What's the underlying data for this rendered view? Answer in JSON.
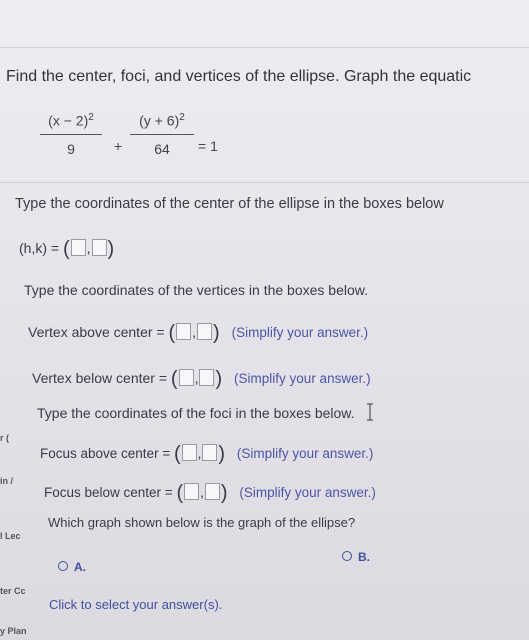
{
  "question": "Find the center, foci, and vertices of the ellipse. Graph the equatic",
  "equation": {
    "term1_num": "(x − 2)",
    "term1_exp": "2",
    "term1_den": "9",
    "plus": "+",
    "term2_num": "(y + 6)",
    "term2_exp": "2",
    "term2_den": "64",
    "rhs": "= 1"
  },
  "center_prompt": "Type the coordinates of the center of the ellipse in the boxes below",
  "center_label": "(h,k) =",
  "vertices_prompt": "Type the coordinates of the vertices in the boxes below.",
  "vertex_above_label": "Vertex above center =",
  "vertex_below_label": "Vertex below center =",
  "foci_prompt": "Type the coordinates of the foci in the boxes below.",
  "focus_above_label": "Focus above center =",
  "focus_below_label": "Focus below center =",
  "simplify_hint": "(Simplify your answer.)",
  "graph_prompt": "Which graph shown below is the graph of the ellipse?",
  "option_a": "A.",
  "option_b": "B.",
  "click_prompt": "Click to select your answer(s).",
  "side_labels": [
    "r (",
    "in /",
    "l Lec",
    "ter Cc",
    "y Plan"
  ],
  "colors": {
    "link": "#3f4fa0",
    "text": "#3a3a44",
    "background": "#e8e6ec"
  }
}
